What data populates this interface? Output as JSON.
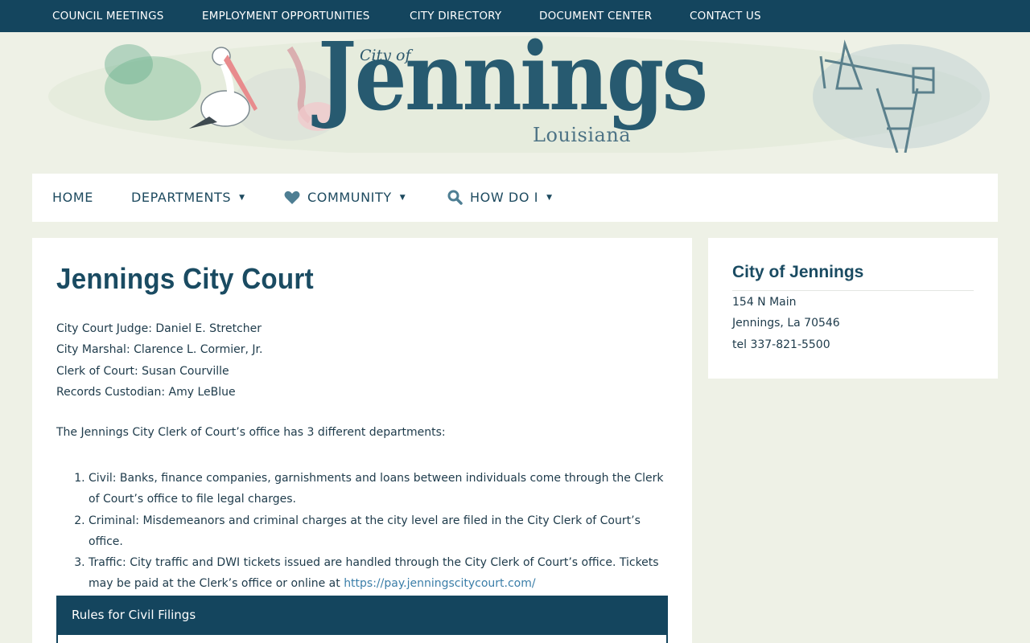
{
  "topnav": {
    "items": [
      "COUNCIL MEETINGS",
      "EMPLOYMENT OPPORTUNITIES",
      "CITY DIRECTORY",
      "DOCUMENT CENTER",
      "CONTACT US"
    ]
  },
  "logo": {
    "city_of": "City of",
    "name": "Jennings",
    "state": "Louisiana"
  },
  "mainnav": {
    "home": "HOME",
    "departments": "DEPARTMENTS",
    "community": "COMMUNITY",
    "howdoi": "HOW DO I",
    "caret": "▼"
  },
  "page": {
    "title": "Jennings City Court",
    "staff": [
      "City Court Judge: Daniel E. Stretcher",
      "City Marshal: Clarence L. Cormier, Jr.",
      "Clerk of Court: Susan Courville",
      "Records Custodian: Amy LeBlue"
    ],
    "intro": "The Jennings City Clerk of Court’s office has 3 different departments:",
    "departments": [
      "Civil:  Banks, finance companies, garnishments and loans between individuals come through the Clerk of Court’s office to file legal charges.",
      "Criminal:  Misdemeanors and criminal charges at the city level are filed in the City Clerk of Court’s office.",
      "Traffic:  City traffic and DWI tickets issued are handled through the City Clerk of Court’s office.  Tickets may be paid at the Clerk’s office or online at "
    ],
    "traffic_link": "https://pay.jenningscitycourt.com/",
    "rules_heading": "Rules for Civil Filings"
  },
  "sidebar": {
    "title": "City of Jennings",
    "address": [
      "154 N Main",
      "Jennings, La 70546",
      "tel 337-821-5500"
    ]
  },
  "colors": {
    "navy": "#14455e",
    "page_bg": "#eef1e6",
    "title_blue": "#1a4b62",
    "link_blue": "#3b7ea8"
  }
}
